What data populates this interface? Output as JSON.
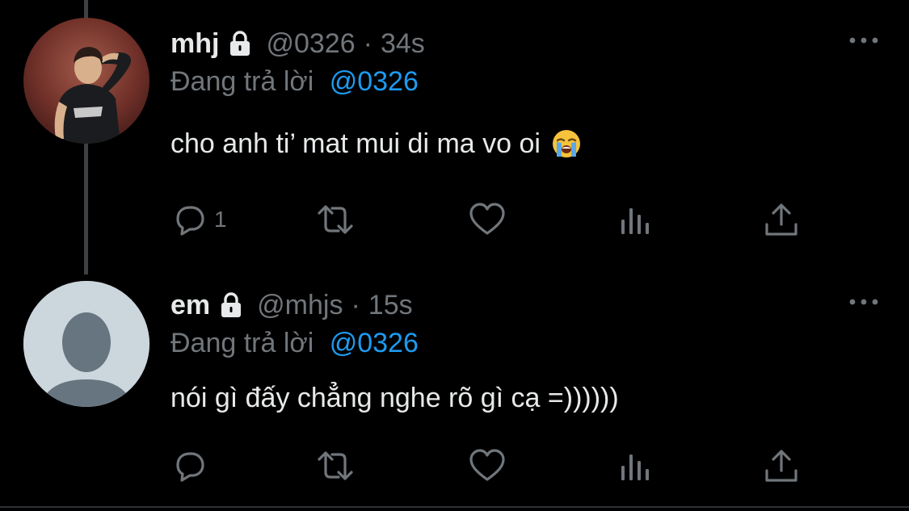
{
  "tweets": [
    {
      "display_name": "mhj",
      "handle": "@0326",
      "separator": "·",
      "time": "34s",
      "reply_prefix": "Đang trả lời",
      "reply_to": "@0326",
      "text": "cho anh ti’ mat mui di ma vo oi",
      "emoji": "loudly-crying-face",
      "reply_count": "1",
      "avatar": "profile-photo"
    },
    {
      "display_name": "em",
      "handle": "@mhjs",
      "separator": "·",
      "time": "15s",
      "reply_prefix": "Đang trả lời",
      "reply_to": "@0326",
      "text": "nói gì đấy chẳng nghe rõ gì cạ =))))))",
      "reply_count": "",
      "avatar": "default-avatar"
    }
  ],
  "colors": {
    "background": "#000000",
    "text_primary": "#e7e9ea",
    "text_secondary": "#71767b",
    "accent": "#1d9bf0",
    "thread_line": "#3e4144"
  },
  "icons": {
    "lock": "lock-icon",
    "more": "more-horizontal-icon",
    "reply": "reply-icon",
    "retweet": "retweet-icon",
    "like": "heart-icon",
    "stats": "analytics-icon",
    "share": "share-icon"
  }
}
